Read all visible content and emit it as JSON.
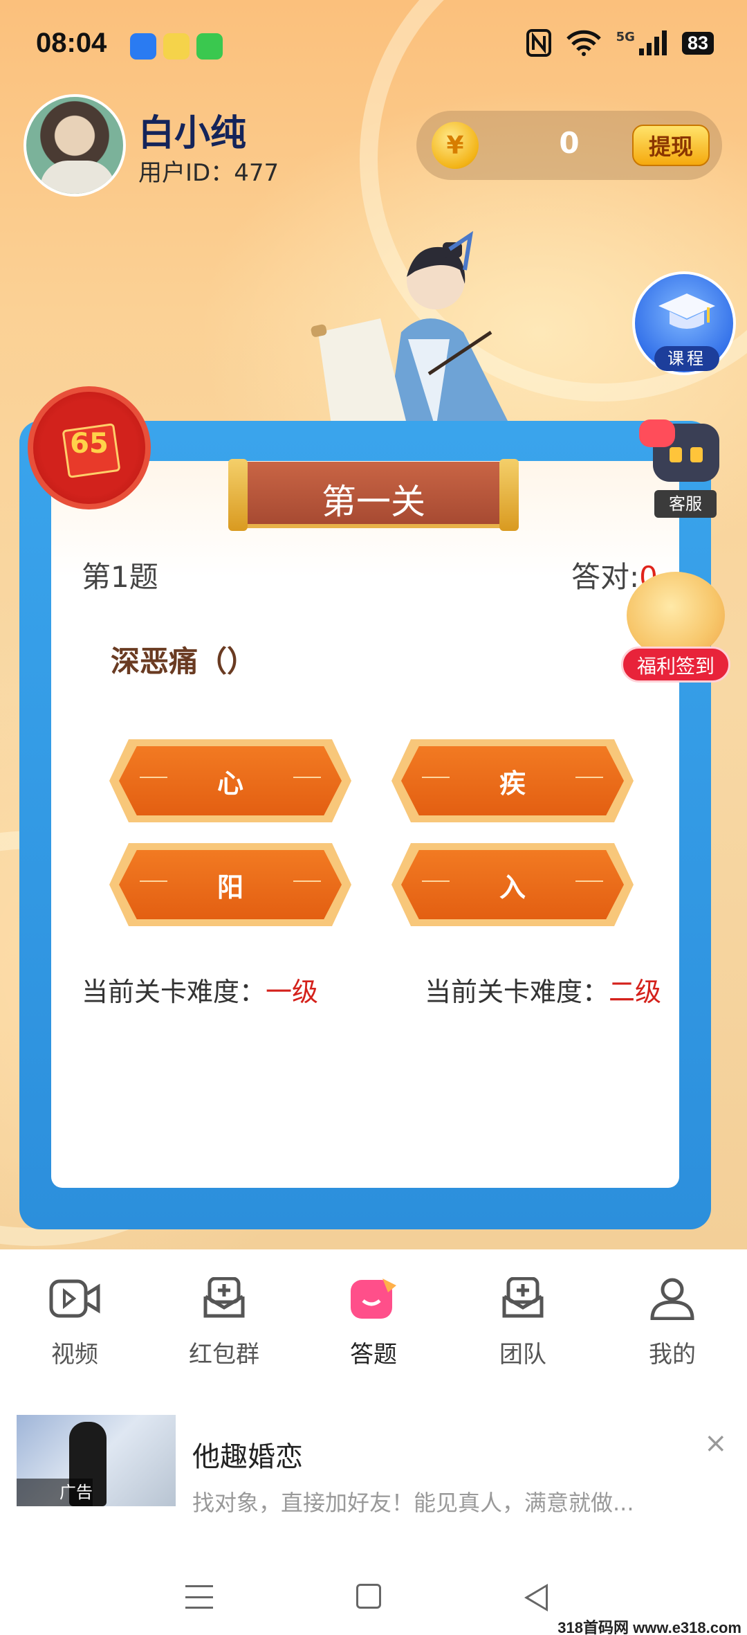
{
  "status_bar": {
    "time": "08:04",
    "network": "5G",
    "battery": "83"
  },
  "user": {
    "name": "白小纯",
    "id_label": "用户ID：477"
  },
  "coins": {
    "symbol": "¥",
    "value": "0",
    "withdraw_label": "提现"
  },
  "course": {
    "label": "课程"
  },
  "redpacket": {
    "count": "65"
  },
  "service": {
    "label": "客服"
  },
  "checkin": {
    "label": "福利签到"
  },
  "quiz": {
    "level_title": "第一关",
    "question_number": "第1题",
    "correct_label": "答对:",
    "correct_value": "0",
    "question": "深恶痛（）",
    "options": [
      "心",
      "疾",
      "阳",
      "入"
    ],
    "difficulty_left_label": "当前关卡难度：",
    "difficulty_left_value": "一级",
    "difficulty_right_label": "当前关卡难度：",
    "difficulty_right_value": "二级"
  },
  "bottom_nav": [
    {
      "label": "视频",
      "icon": "video-icon"
    },
    {
      "label": "红包群",
      "icon": "inbox-add-icon"
    },
    {
      "label": "答题",
      "icon": "quiz-icon",
      "active": true
    },
    {
      "label": "团队",
      "icon": "inbox-add-icon"
    },
    {
      "label": "我的",
      "icon": "user-icon"
    }
  ],
  "ad": {
    "tag": "广告",
    "title": "他趣婚恋",
    "description": "找对象，直接加好友！能见真人，满意就做...",
    "close": "×"
  },
  "watermark": "318首码网 www.e318.com",
  "colors": {
    "accent_orange": "#f27a22",
    "board_blue": "#2c8fdc",
    "danger_red": "#e0241b"
  }
}
